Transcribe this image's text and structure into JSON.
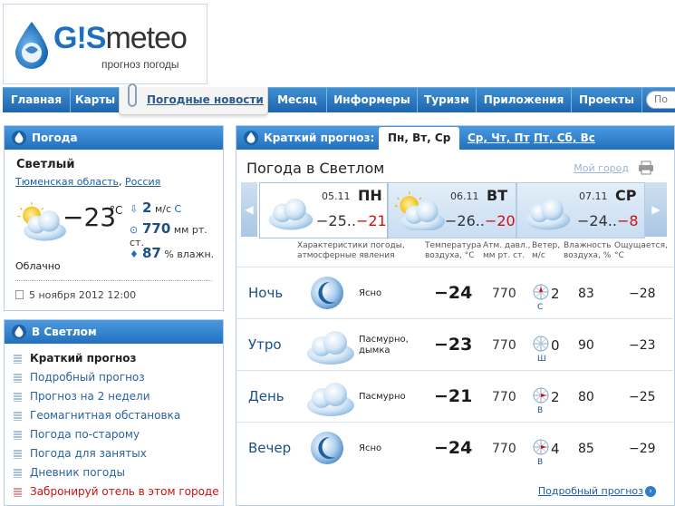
{
  "header": {
    "logo_brand": "GISMETEO",
    "logo_brand_gis": "G!S",
    "logo_brand_meteo": "meteo",
    "logo_sub": "прогноз погоды"
  },
  "nav": {
    "items": [
      {
        "label": "Главная"
      },
      {
        "label": "Карты"
      },
      {
        "label": "Погодные новости"
      },
      {
        "label": "Месяц"
      },
      {
        "label": "Информеры"
      },
      {
        "label": "Туризм"
      },
      {
        "label": "Приложения"
      },
      {
        "label": "Проекты"
      }
    ],
    "search_placeholder": "По"
  },
  "current": {
    "panel_title": "Погода",
    "city": "Светлый",
    "region": "Тюменская область",
    "country": "Россия",
    "temperature": "−23",
    "degree_unit": "°C",
    "condition": "Облачно",
    "wind_value": "2",
    "wind_unit": "м/с",
    "wind_dir": "С",
    "pressure_value": "770",
    "pressure_unit": "мм рт. ст.",
    "humidity_value": "87",
    "humidity_unit": "% влажн.",
    "date": "5 ноября 2012 12:00"
  },
  "city_menu": {
    "panel_title": "В Светлом",
    "items": [
      {
        "label": "Краткий прогноз"
      },
      {
        "label": "Подробный прогноз"
      },
      {
        "label": "Прогноз на 2 недели"
      },
      {
        "label": "Геомагнитная обстановка"
      },
      {
        "label": "Погода по-старому"
      },
      {
        "label": "Погода для занятых"
      },
      {
        "label": "Дневник погоды"
      },
      {
        "label": "Забронируй отель в этом городе"
      }
    ]
  },
  "forecast": {
    "panel_title": "Краткий прогноз:",
    "tabs": [
      {
        "label": "Пн, Вт, Ср"
      },
      {
        "label": "Ср, Чт, Пт"
      },
      {
        "label": "Пт, Сб, Вс"
      }
    ],
    "title": "Погода в Светлом",
    "my_city": "Мой город",
    "days": [
      {
        "date": "05.11",
        "name": "ПН",
        "min": "−25..",
        "max": "−21"
      },
      {
        "date": "06.11",
        "name": "ВТ",
        "min": "−26..",
        "max": "−20"
      },
      {
        "date": "07.11",
        "name": "СР",
        "min": "−24..",
        "max": "−8"
      }
    ],
    "columns": {
      "conditions": "Характеристики погоды,",
      "conditions2": "атмосферные явления",
      "temp": "Температура",
      "temp2": "воздуха, °C",
      "pressure": "Атм. давл.,",
      "pressure2": "мм рт. ст.",
      "wind": "Ветер,",
      "wind2": "м/с",
      "humidity": "Влажность",
      "humidity2": "воздуха, %",
      "feels": "Ощущается,",
      "feels2": "°C"
    },
    "rows": [
      {
        "label": "Ночь",
        "desc": "Ясно",
        "desc2": "",
        "temp": "−24",
        "pressure": "770",
        "wind_dir": "С",
        "wind": "2",
        "humidity": "83",
        "feels": "−28"
      },
      {
        "label": "Утро",
        "desc": "Пасмурно,",
        "desc2": "дымка",
        "temp": "−23",
        "pressure": "770",
        "wind_dir": "Ш",
        "wind": "0",
        "humidity": "90",
        "feels": "−23"
      },
      {
        "label": "День",
        "desc": "Пасмурно",
        "desc2": "",
        "temp": "−21",
        "pressure": "770",
        "wind_dir": "В",
        "wind": "2",
        "humidity": "80",
        "feels": "−25"
      },
      {
        "label": "Вечер",
        "desc": "Ясно",
        "desc2": "",
        "temp": "−24",
        "pressure": "770",
        "wind_dir": "В",
        "wind": "4",
        "humidity": "85",
        "feels": "−29"
      }
    ],
    "detail_link": "Подробный прогноз"
  }
}
